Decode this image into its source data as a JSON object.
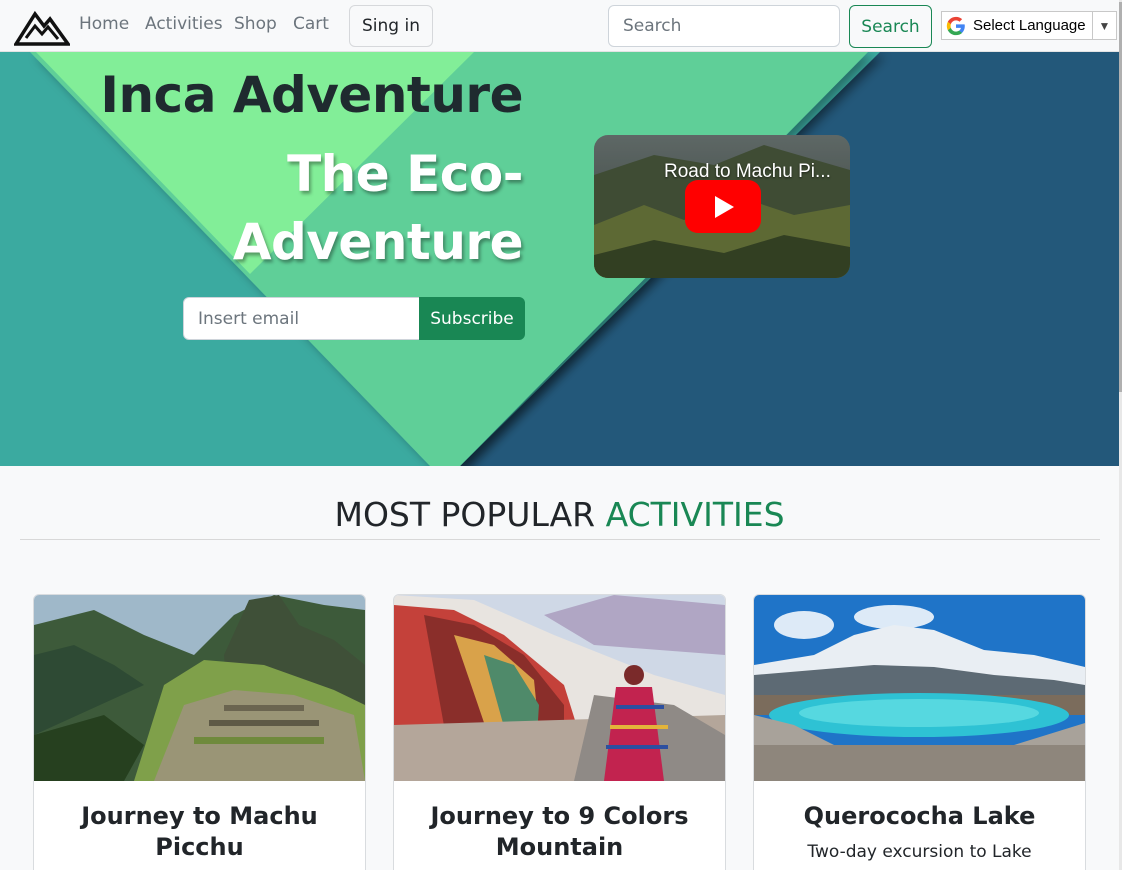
{
  "nav": {
    "links": [
      "Home",
      "Activities",
      "Shop",
      "Cart"
    ],
    "signin_label": "Sing in",
    "search_placeholder": "Search",
    "search_button": "Search",
    "language_label": "Select Language"
  },
  "hero": {
    "title": "Inca Adventure",
    "subtitle_line1": "The Eco-",
    "subtitle_line2": "Adventure",
    "email_placeholder": "Insert email",
    "subscribe_label": "Subscribe",
    "video_title": "Road to Machu Pi..."
  },
  "section": {
    "title_main": "MOST POPULAR",
    "title_accent": "ACTIVITIES"
  },
  "cards": [
    {
      "title_line1": "Journey to Machu",
      "title_line2": "Picchu",
      "text": ""
    },
    {
      "title_line1": "Journey to 9 Colors",
      "title_line2": "Mountain",
      "text": ""
    },
    {
      "title_line1": "Querococha Lake",
      "title_line2": "",
      "text": "Two-day excursion to Lake"
    }
  ],
  "colors": {
    "accent": "#198754",
    "hero_teal": "#3aaaa0",
    "hero_green": "#5ecf98",
    "hero_light_green": "#82ee98",
    "hero_navy": "#23587a"
  }
}
